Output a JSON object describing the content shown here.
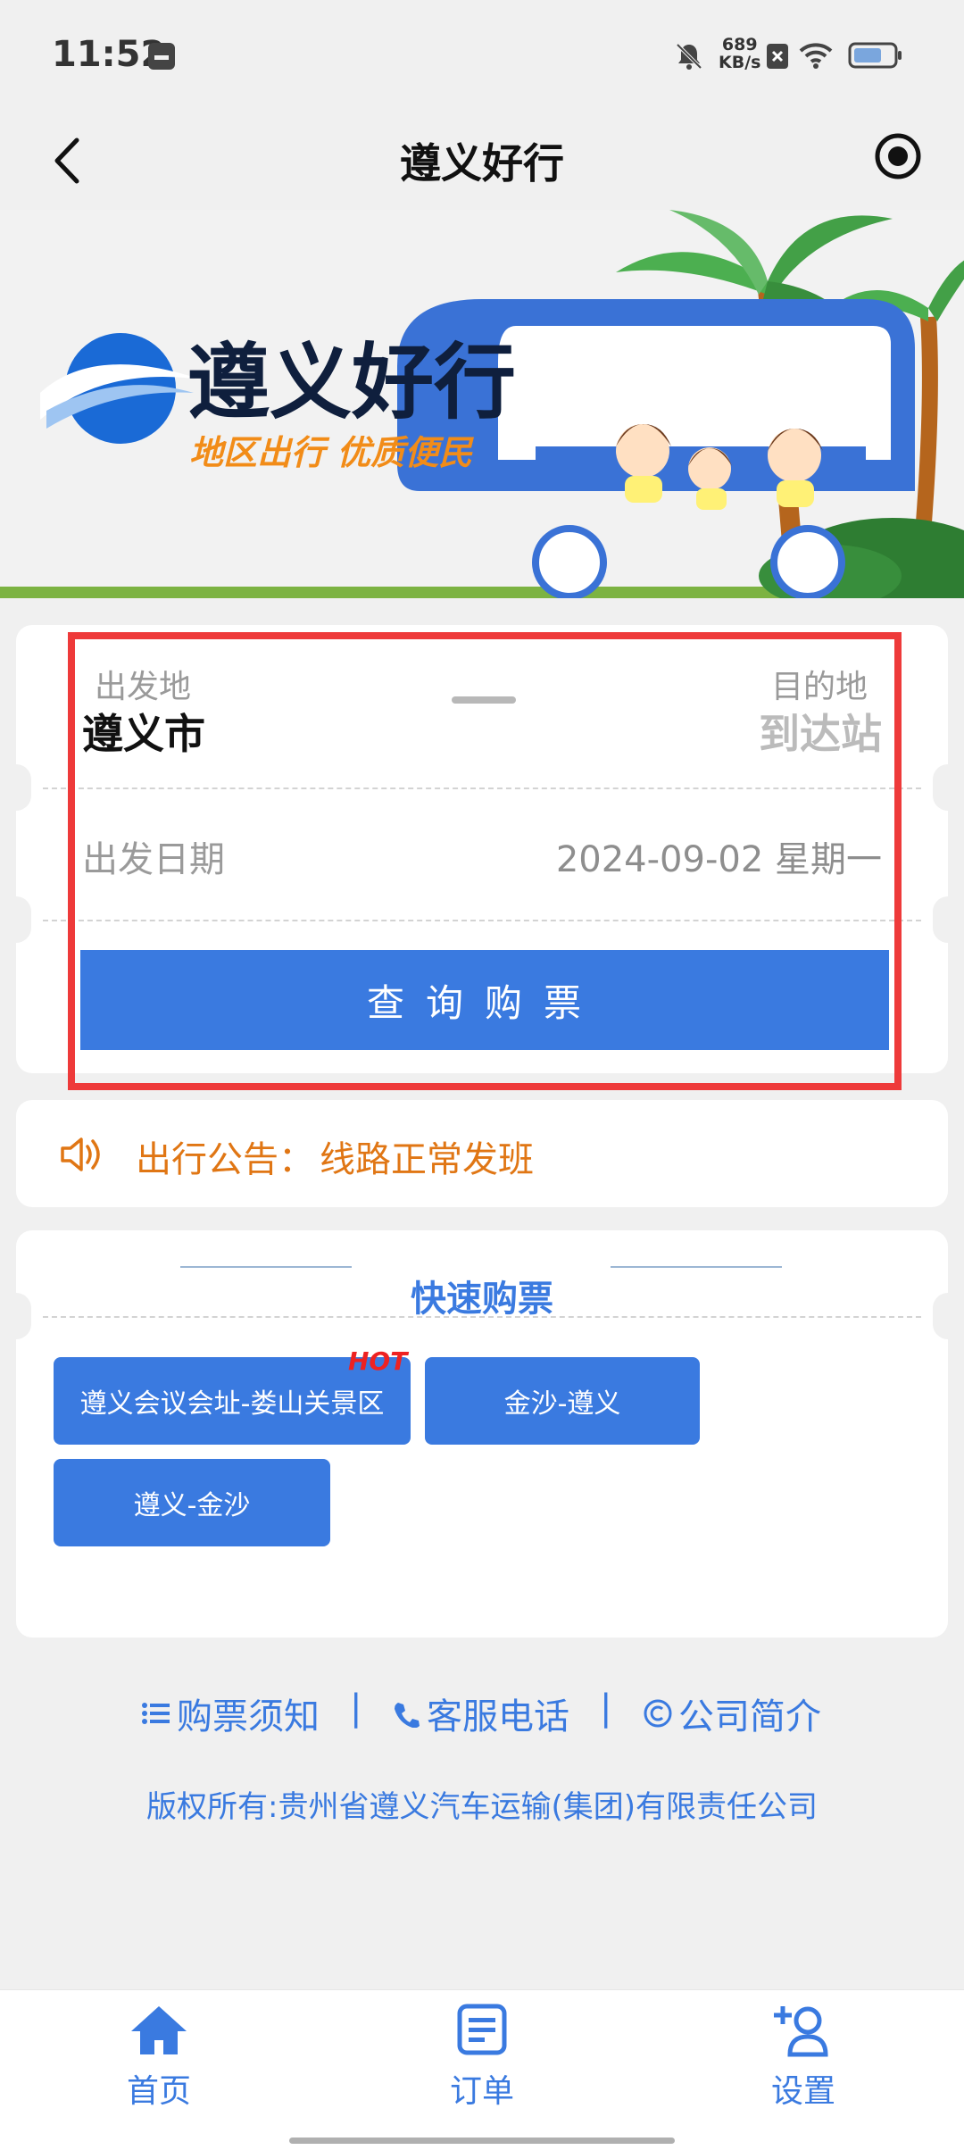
{
  "status_bar": {
    "time": "11:52",
    "net_speed_value": "689",
    "net_speed_unit": "KB/s"
  },
  "header": {
    "title": "遵义好行"
  },
  "banner": {
    "logo_title": "遵义好行",
    "slogan": "地区出行 优质便民"
  },
  "search": {
    "from_label": "出发地",
    "from_city": "遵义市",
    "to_label": "目的地",
    "to_city": "到达站",
    "date_label": "出发日期",
    "date_value": "2024-09-02 星期一",
    "query_button": "查询购票"
  },
  "notice": {
    "label": "出行公告：",
    "text": "线路正常发班"
  },
  "quick_buy": {
    "title": "快速购票",
    "hot_badge": "HOT",
    "routes": [
      "遵义会议会址-娄山关景区",
      "金沙-遵义",
      "遵义-金沙"
    ]
  },
  "footer": {
    "links": [
      "购票须知",
      "客服电话",
      "公司简介"
    ],
    "separator": "|",
    "copyright": "版权所有:贵州省遵义汽车运输(集团)有限责任公司"
  },
  "bottom_nav": {
    "items": [
      "首页",
      "订单",
      "设置"
    ],
    "active_color": "#3a7ae0",
    "inactive_color": "#3a7ae0"
  },
  "colors": {
    "primary": "#3a7ae0",
    "notice": "#e07614",
    "highlight_frame": "#ee3a3a",
    "hot": "#e22222"
  }
}
